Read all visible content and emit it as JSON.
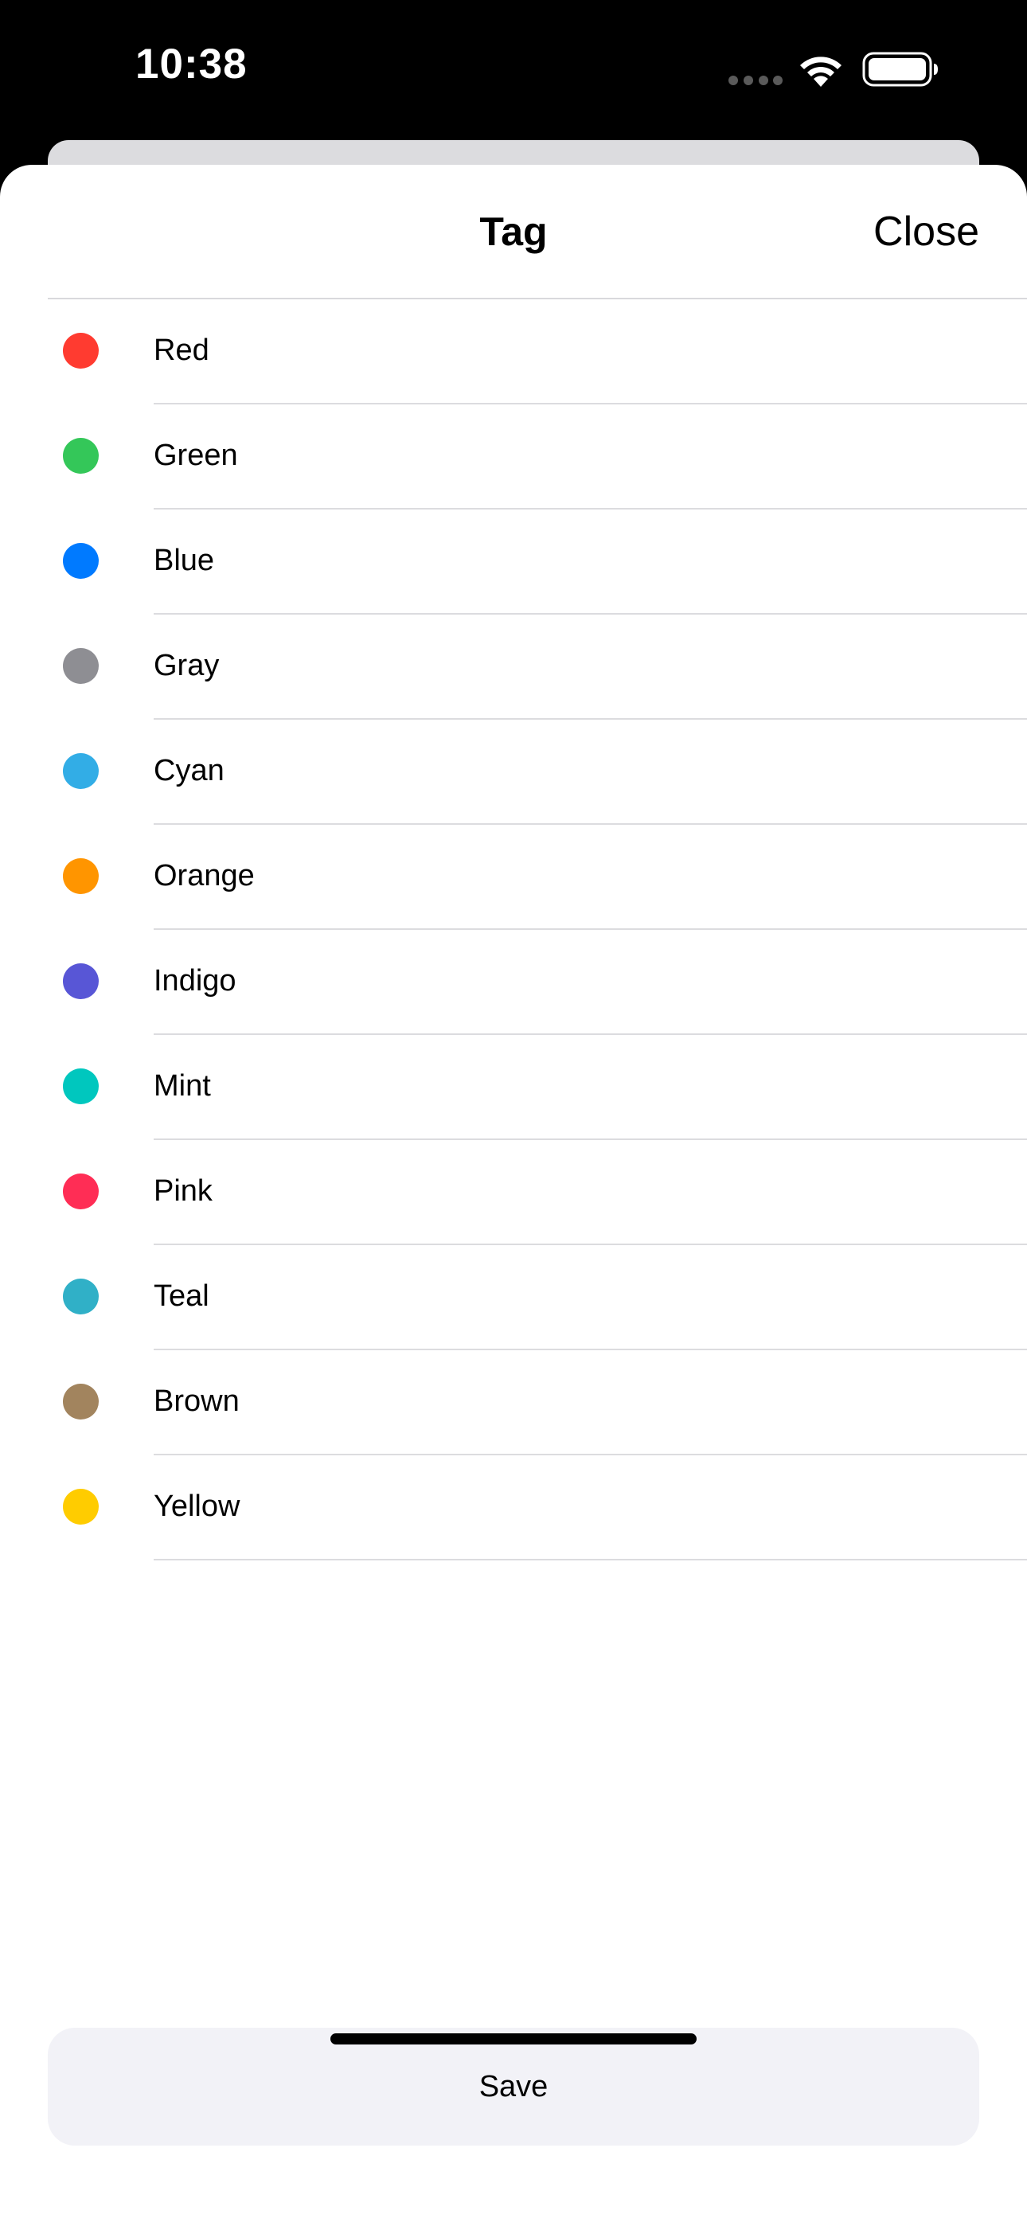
{
  "status_bar": {
    "time": "10:38"
  },
  "sheet": {
    "title": "Tag",
    "close_label": "Close",
    "save_label": "Save"
  },
  "tags": [
    {
      "label": "Red",
      "color": "#FF3B30"
    },
    {
      "label": "Green",
      "color": "#34C759"
    },
    {
      "label": "Blue",
      "color": "#007AFF"
    },
    {
      "label": "Gray",
      "color": "#8E8E93"
    },
    {
      "label": "Cyan",
      "color": "#32ADE6"
    },
    {
      "label": "Orange",
      "color": "#FF9500"
    },
    {
      "label": "Indigo",
      "color": "#5856D6"
    },
    {
      "label": "Mint",
      "color": "#00C7BE"
    },
    {
      "label": "Pink",
      "color": "#FF2D55"
    },
    {
      "label": "Teal",
      "color": "#30B0C7"
    },
    {
      "label": "Brown",
      "color": "#A2845E"
    },
    {
      "label": "Yellow",
      "color": "#FFCC00"
    }
  ],
  "icons": {
    "wifi": "wifi-icon",
    "battery": "battery-icon",
    "signal": "signal-dots-icon"
  }
}
